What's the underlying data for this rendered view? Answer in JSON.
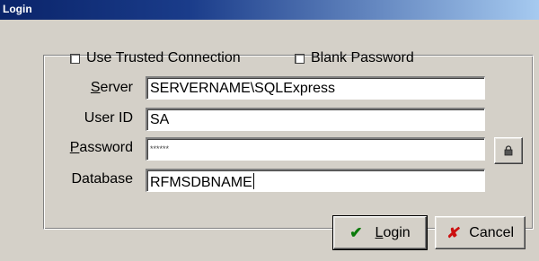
{
  "window": {
    "title": "Login"
  },
  "options": {
    "trusted_label": "Use Trusted Connection",
    "blank_password_label": "Blank Password"
  },
  "fields": {
    "server": {
      "label_pre": "",
      "label_u": "S",
      "label_post": "erver",
      "value": "SERVERNAME\\SQLExpress"
    },
    "userid": {
      "label": "User ID",
      "value": "SA"
    },
    "password": {
      "label_pre": "",
      "label_u": "P",
      "label_post": "assword",
      "value": "******"
    },
    "database": {
      "label": "Database",
      "value": "RFMSDBNAME"
    }
  },
  "buttons": {
    "login": {
      "label_u": "L",
      "label_post": "ogin",
      "icon": "check-icon"
    },
    "cancel": {
      "label": "Cancel",
      "icon": "x-icon"
    },
    "lock": {
      "icon": "lock-icon"
    }
  },
  "colors": {
    "title_bar": "#0a246a",
    "background": "#d4d0c8",
    "check": "#0a7a0a",
    "cancel_x": "#cc1010"
  }
}
